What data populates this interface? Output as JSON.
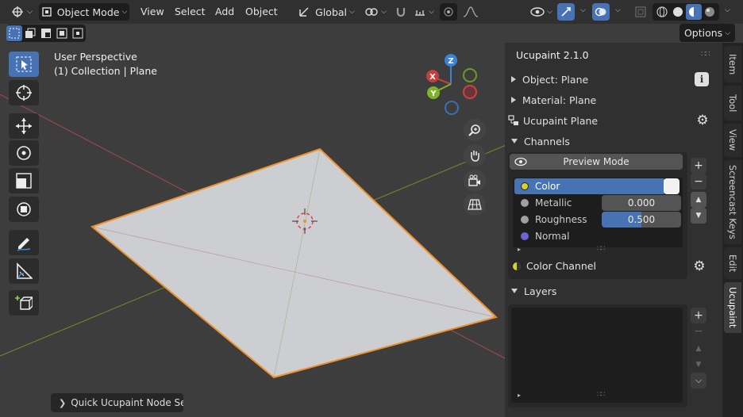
{
  "header": {
    "mode_label": "Object Mode",
    "menus": [
      "View",
      "Select",
      "Add",
      "Object"
    ],
    "transform_orientation": "Global",
    "options_label": "Options"
  },
  "viewport": {
    "perspective_label": "User Perspective",
    "collection_label": "(1) Collection | Plane",
    "gizmo_axes": [
      "X",
      "Y",
      "Z"
    ],
    "operator_panel_label": "Quick Ucupaint Node Setu",
    "colors": {
      "grid_red": "#a84a4a",
      "grid_green": "#6c8f2a",
      "plane": "#cdced1",
      "outline": "#f0902a"
    }
  },
  "npanel": {
    "title": "Ucupaint 2.1.0",
    "object_row": "Object: Plane",
    "material_row": "Material: Plane",
    "ucupaint_row": "Ucupaint Plane",
    "channels_header": "Channels",
    "preview_mode_label": "Preview Mode",
    "channels": [
      {
        "name": "Color",
        "dot_color": "#d6d02a",
        "value": ""
      },
      {
        "name": "Metallic",
        "dot_color": "#a0a0a0",
        "value": "0.000"
      },
      {
        "name": "Roughness",
        "dot_color": "#a0a0a0",
        "value": "0.500"
      },
      {
        "name": "Normal",
        "dot_color": "#6c63d6",
        "value": ""
      }
    ],
    "color_channel_label": "Color Channel",
    "layers_header": "Layers"
  },
  "tabs": [
    "Item",
    "Tool",
    "View",
    "Screencast Keys",
    "Edit",
    "Ucupaint"
  ]
}
